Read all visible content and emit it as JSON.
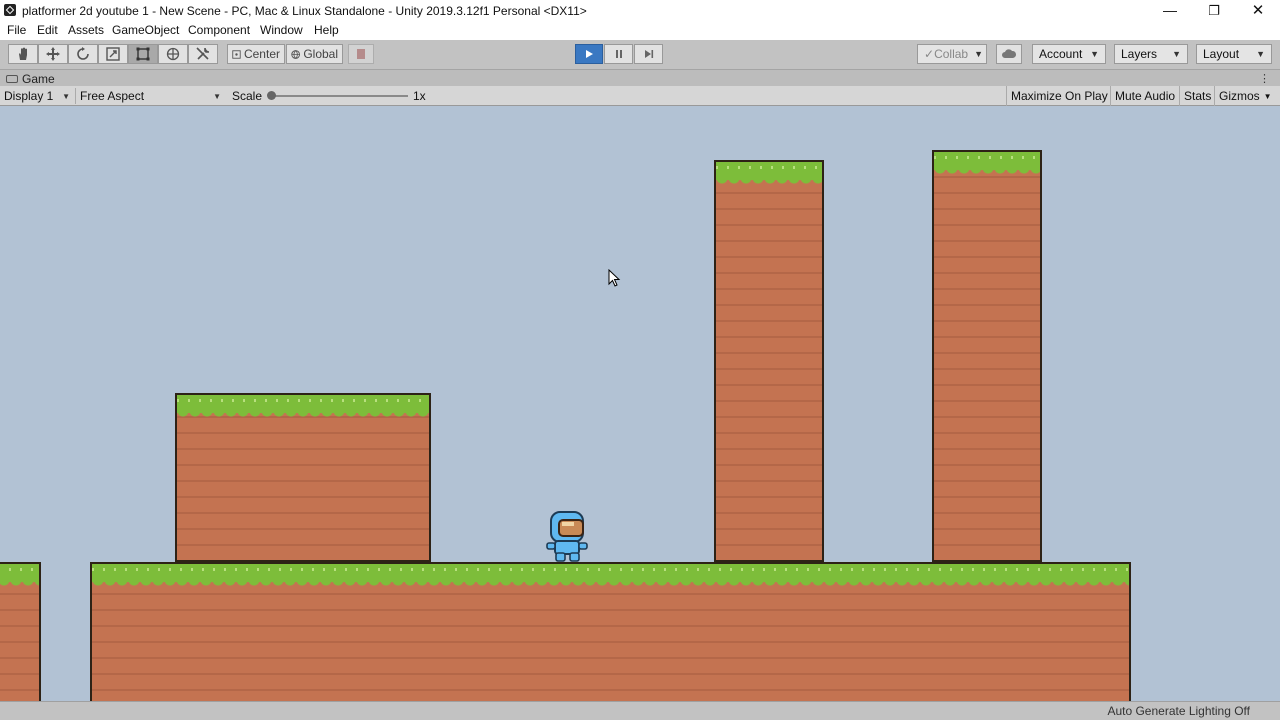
{
  "window": {
    "title": "platformer 2d youtube 1 - New Scene - PC, Mac & Linux Standalone - Unity 2019.3.12f1 Personal <DX11>",
    "controls": {
      "minimize": "—",
      "maximize": "❐",
      "close": "✕"
    }
  },
  "menu": {
    "items": [
      "File",
      "Edit",
      "Assets",
      "GameObject",
      "Component",
      "Window",
      "Help"
    ]
  },
  "toolbar": {
    "tools": [
      "hand-tool",
      "move-tool",
      "rotate-tool",
      "scale-tool",
      "rect-tool",
      "transform-tool",
      "custom-tool"
    ],
    "pivot_mode": "Center",
    "pivot_rotation": "Global",
    "collab": "Collab",
    "account": "Account",
    "layers": "Layers",
    "layout": "Layout"
  },
  "game_view": {
    "tab_label": "Game",
    "display": "Display 1",
    "aspect": "Free Aspect",
    "scale_label": "Scale",
    "scale_value": "1x",
    "buttons": [
      "Maximize On Play",
      "Mute Audio",
      "Stats",
      "Gizmos"
    ]
  },
  "status": {
    "text": "Auto Generate Lighting Off"
  },
  "colors": {
    "play_accent": "#3a78c2",
    "grass": "#7dbd3a",
    "dirt": "#c47351"
  }
}
